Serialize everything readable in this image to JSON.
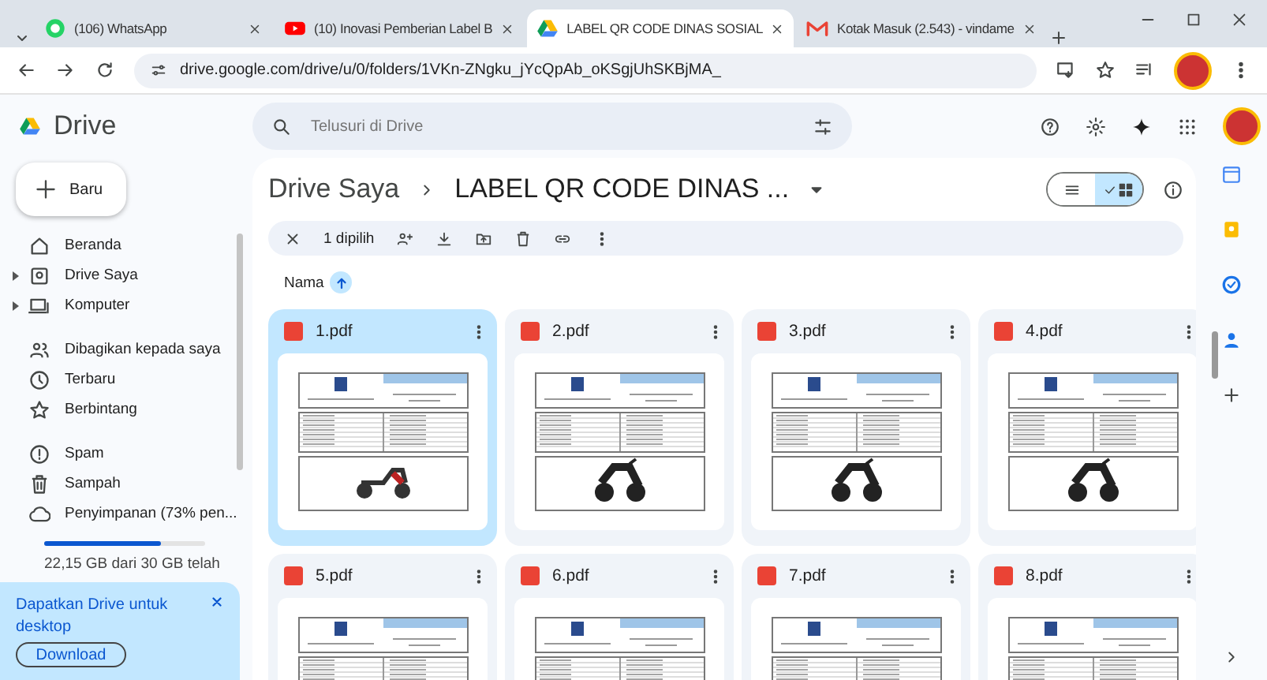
{
  "browser": {
    "tabs": [
      {
        "title": "(106) WhatsApp",
        "selected": false,
        "kind": "whatsapp"
      },
      {
        "title": "(10) Inovasi Pemberian Label B",
        "selected": false,
        "kind": "youtube"
      },
      {
        "title": "LABEL QR CODE DINAS SOSIAL",
        "selected": true,
        "kind": "drive"
      },
      {
        "title": "Kotak Masuk (2.543) - vindame",
        "selected": false,
        "kind": "gmail"
      }
    ],
    "url": "drive.google.com/drive/u/0/folders/1VKn-ZNgku_jYcQpAb_oKSgjUhSKBjMA_"
  },
  "app": {
    "name": "Drive",
    "search": {
      "placeholder": "Telusuri di Drive"
    }
  },
  "sidebar": {
    "new_button": "Baru",
    "sections": [
      [
        {
          "label": "Beranda",
          "expandable": false
        },
        {
          "label": "Drive Saya",
          "expandable": true
        },
        {
          "label": "Komputer",
          "expandable": true
        }
      ],
      [
        {
          "label": "Dibagikan kepada saya",
          "expandable": false
        },
        {
          "label": "Terbaru",
          "expandable": false
        },
        {
          "label": "Berbintang",
          "expandable": false
        }
      ],
      [
        {
          "label": "Spam",
          "expandable": false
        },
        {
          "label": "Sampah",
          "expandable": false
        },
        {
          "label": "Penyimpanan (73% pen...",
          "expandable": false
        }
      ]
    ],
    "storage": {
      "level": 0.73,
      "text": "22,15 GB dari 30 GB telah"
    },
    "promo": {
      "text": "Dapatkan Drive untuk desktop",
      "button": "Download"
    }
  },
  "main": {
    "breadcrumb": [
      "Drive Saya",
      "LABEL QR CODE DINAS ..."
    ],
    "view_toggle": [
      {
        "kind": "list",
        "selected": false
      },
      {
        "kind": "grid",
        "selected": true
      }
    ],
    "selection": {
      "count": "1 dipilih"
    },
    "sort": {
      "label": "Nama"
    },
    "files": [
      {
        "name": "1.pdf",
        "selected": true
      },
      {
        "name": "2.pdf",
        "selected": false
      },
      {
        "name": "3.pdf",
        "selected": false
      },
      {
        "name": "4.pdf",
        "selected": false
      },
      {
        "name": "5.pdf",
        "selected": false
      },
      {
        "name": "6.pdf",
        "selected": false
      },
      {
        "name": "7.pdf",
        "selected": false
      },
      {
        "name": "8.pdf",
        "selected": false
      }
    ]
  }
}
